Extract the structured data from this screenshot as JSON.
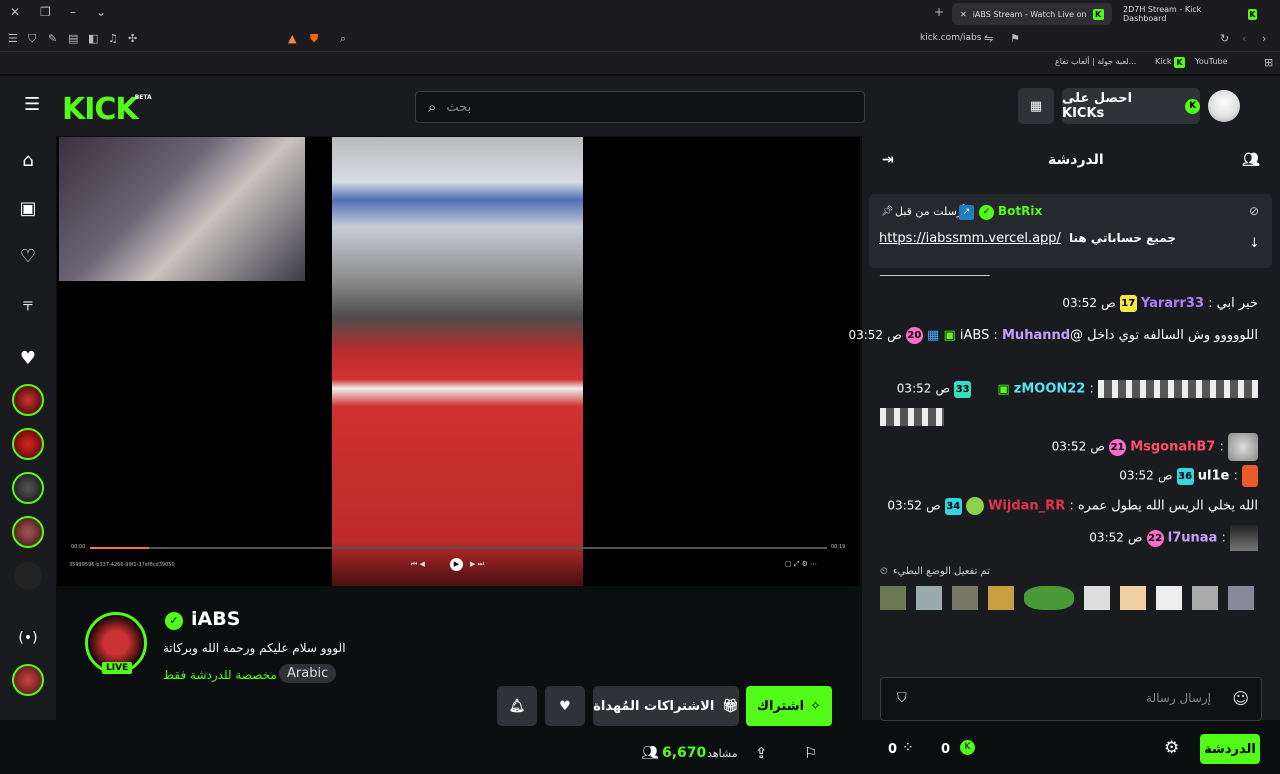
{
  "browser": {
    "tabs": [
      {
        "label": "iABS Stream - Watch Live on"
      },
      {
        "label": "2D7H Stream - Kick Dashboard"
      }
    ],
    "url": "kick.com/iabs",
    "bookmarks": [
      "لعبة جولة | ألعاب تفاع...",
      "Kick",
      "YouTube"
    ]
  },
  "header": {
    "logo": "KICK",
    "logo_tag": "BETA",
    "search_placeholder": "بحث",
    "get_kicks": "احصل على KICKs"
  },
  "colors": {
    "accent": "#53fc18",
    "bg": "#0b0e0f",
    "panel": "#191b1f"
  },
  "player": {
    "time_left": "00:00",
    "time_right": "00:19",
    "stream_id": "35999596-b337-4266-99f1-37ef8cd39050"
  },
  "channel": {
    "name": "iABS",
    "title": "الووو سلام عليكم ورحمة الله وبركاتة",
    "category": "مخصصة للدردشة فقط",
    "language": "Arabic",
    "live_label": "LIVE",
    "viewers": "6,670",
    "viewers_label": "مشاهد",
    "subscribe": "اشتراك",
    "gift_subs": "الاشتراكات المُهداة"
  },
  "chat": {
    "title": "الدردشة",
    "pinned": {
      "user": "BotRix",
      "label": "أرسلت من قبل",
      "link": "https://iabssmm.vercel.app/",
      "text": "جميع حساباتي هنا"
    },
    "partial_line": "ــــــــــــــــــــــــــــــــــ",
    "messages": [
      {
        "time": "03:52",
        "ampm": "ص",
        "badge": "17",
        "user": "Yararr33",
        "text": "خير ابي",
        "color": "#b57cff",
        "badge_color": "#f5e642"
      },
      {
        "time": "03:52",
        "ampm": "ص",
        "badge": "20",
        "user": "Muhannd",
        "text": "اللووووو وش السالفه توي داخل @iABS",
        "color": "#c6a0ff",
        "badge_color": "#ff6bd0"
      },
      {
        "time": "03:52",
        "ampm": "ص",
        "badge": "33",
        "user": "zMOON22",
        "text": "",
        "color": "#54e6f7",
        "badge_color": "#33e0c0"
      },
      {
        "time": "03:52",
        "ampm": "ص",
        "badge": "21",
        "user": "MsgonahB7",
        "text": "",
        "color": "#ff4d6a",
        "badge_color": "#ff6bd0"
      },
      {
        "time": "03:52",
        "ampm": "ص",
        "badge": "36",
        "user": "ul1e",
        "text": "",
        "color": "#ffffff",
        "badge_color": "#33d6e0"
      },
      {
        "time": "03:52",
        "ampm": "ص",
        "badge": "34",
        "user": "Wijdan_RR",
        "text": "الله يخلي الريس الله يطول عمره",
        "color": "#e3334d",
        "badge_color": "#33d6e0"
      },
      {
        "time": "03:52",
        "ampm": "ص",
        "badge": "22",
        "user": "l7unaa",
        "text": "",
        "color": "#c6a0ff",
        "badge_color": "#ff6bd0"
      }
    ],
    "slow_mode": "تم تفعيل الوضع البطيء",
    "input_placeholder": "إرسال رسالة",
    "send_label": "الدردشة",
    "points": "0",
    "kicks": "0"
  }
}
